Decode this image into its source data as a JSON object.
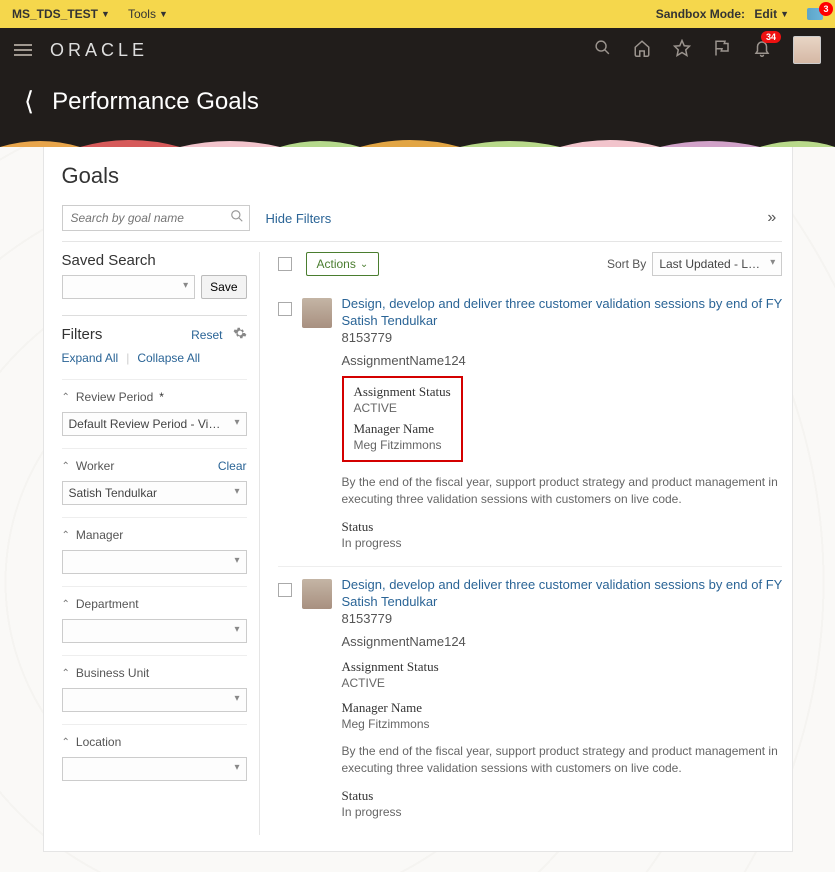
{
  "sandbox": {
    "left_items": [
      "MS_TDS_TEST",
      "Tools"
    ],
    "mode_label": "Sandbox Mode:",
    "mode_value": "Edit",
    "bubble_count": "3"
  },
  "global": {
    "logo": "ORACLE",
    "bell_count": "34"
  },
  "header": {
    "title": "Performance Goals"
  },
  "panel": {
    "title": "Goals",
    "search_placeholder": "Search by goal name",
    "hide_filters": "Hide Filters"
  },
  "saved_search": {
    "label": "Saved Search",
    "save_btn": "Save"
  },
  "filters": {
    "title": "Filters",
    "reset": "Reset",
    "expand": "Expand All",
    "collapse": "Collapse All",
    "sections": {
      "review_period": {
        "label": "Review Period",
        "required": "*",
        "value": "Default Review Period - Vision"
      },
      "worker": {
        "label": "Worker",
        "clear": "Clear",
        "value": "Satish Tendulkar"
      },
      "manager": {
        "label": "Manager",
        "value": ""
      },
      "department": {
        "label": "Department",
        "value": ""
      },
      "business_unit": {
        "label": "Business Unit",
        "value": ""
      },
      "location": {
        "label": "Location",
        "value": ""
      }
    }
  },
  "list": {
    "actions_btn": "Actions",
    "sort_by_label": "Sort By",
    "sort_value": "Last Updated - Latest to Oldest"
  },
  "goals": [
    {
      "title": "Design, develop and deliver three customer validation sessions by end of FY",
      "person": "Satish Tendulkar",
      "id": "8153779",
      "assignment": "AssignmentName124",
      "assignment_status_label": "Assignment Status",
      "assignment_status_value": "ACTIVE",
      "manager_label": "Manager Name",
      "manager_value": "Meg Fitzimmons",
      "desc": "By the end of the fiscal year, support product strategy and product management in executing three validation sessions with customers on live code.",
      "status_label": "Status",
      "status_value": "In progress",
      "highlighted": true
    },
    {
      "title": "Design, develop and deliver three customer validation sessions by end of FY",
      "person": "Satish Tendulkar",
      "id": "8153779",
      "assignment": "AssignmentName124",
      "assignment_status_label": "Assignment Status",
      "assignment_status_value": "ACTIVE",
      "manager_label": "Manager Name",
      "manager_value": "Meg Fitzimmons",
      "desc": "By the end of the fiscal year, support product strategy and product management in executing three validation sessions with customers on live code.",
      "status_label": "Status",
      "status_value": "In progress",
      "highlighted": false
    }
  ]
}
